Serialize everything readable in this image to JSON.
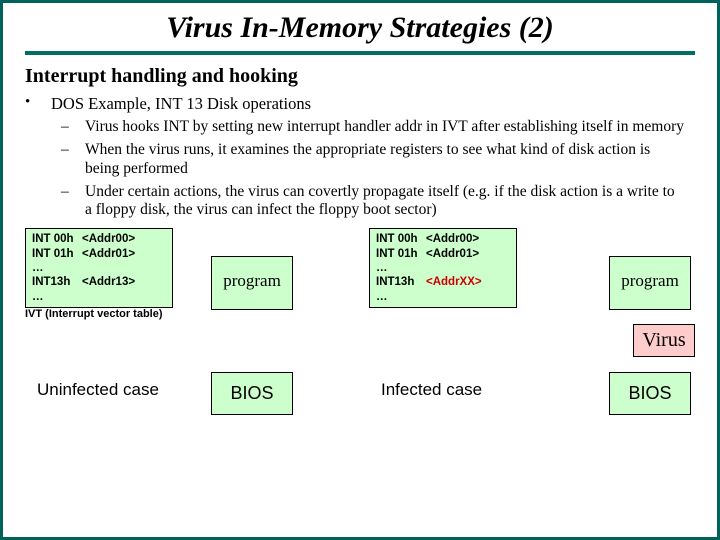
{
  "title": "Virus In-Memory Strategies (2)",
  "subtitle": "Interrupt handling and hooking",
  "bullet": "DOS Example, INT 13 Disk operations",
  "subs": [
    "Virus hooks INT by setting new interrupt handler addr in IVT after establishing itself in memory",
    "When the virus runs, it examines the appropriate registers to see what kind of disk action is being performed",
    "Under certain actions, the virus can covertly propagate itself (e.g. if the disk action is a write to a floppy disk, the virus can infect the floppy boot sector)"
  ],
  "ivt_left": {
    "r0c0": "INT 00h",
    "r0c1": "<Addr00>",
    "r1c0": "INT 01h",
    "r1c1": "<Addr01>",
    "r2c0": "…",
    "r2c1": "",
    "r3c0": "INT13h",
    "r3c1": "<Addr13>",
    "r4c0": "…",
    "r4c1": ""
  },
  "ivt_right": {
    "r0c0": "INT 00h",
    "r0c1": "<Addr00>",
    "r1c0": "INT 01h",
    "r1c1": "<Addr01>",
    "r2c0": "…",
    "r2c1": "",
    "r3c0": "INT13h",
    "r3c1": "<AddrXX>",
    "r4c0": "…",
    "r4c1": ""
  },
  "labels": {
    "program": "program",
    "bios": "BIOS",
    "virus": "Virus",
    "ivt_caption": "IVT (Interrupt vector table)",
    "uninfected": "Uninfected case",
    "infected": "Infected case"
  }
}
